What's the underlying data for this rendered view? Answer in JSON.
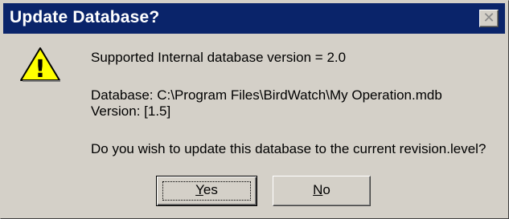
{
  "window": {
    "title": "Update Database?",
    "close_glyph": "✕"
  },
  "icon": {
    "name": "warning-icon",
    "glyph": "!",
    "color": "#ffff00"
  },
  "message": {
    "line1": "Supported Internal database version = 2.0",
    "line2": "Database: C:\\Program Files\\BirdWatch\\My Operation.mdb",
    "line3": "Version: [1.5]",
    "line4": "Do you wish to update this database to the current revision.level?"
  },
  "buttons": {
    "yes": {
      "mnemonic": "Y",
      "rest": "es"
    },
    "no": {
      "mnemonic": "N",
      "rest": "o"
    }
  },
  "colors": {
    "titlebar": "#0a246a",
    "face": "#d4d0c8"
  }
}
